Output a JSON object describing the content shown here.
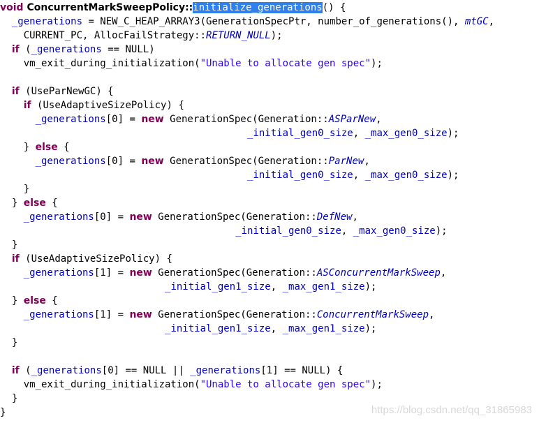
{
  "editor": {
    "lines": [
      [
        {
          "t": "void ",
          "c": "kw"
        },
        {
          "t": "ConcurrentMarkSweepPolicy::",
          "c": "sig"
        },
        {
          "t": "initialize_generations",
          "c": "hl"
        },
        {
          "t": "() {",
          "c": "plain"
        }
      ],
      [
        {
          "t": "  ",
          "c": "plain"
        },
        {
          "t": "_generations",
          "c": "field"
        },
        {
          "t": " = NEW_C_HEAP_ARRAY3(GenerationSpecPtr, number_of_generations(), ",
          "c": "plain"
        },
        {
          "t": "mtGC",
          "c": "italic"
        },
        {
          "t": ",",
          "c": "plain"
        }
      ],
      [
        {
          "t": "    CURRENT_PC, AllocFailStrategy::",
          "c": "plain"
        },
        {
          "t": "RETURN_NULL",
          "c": "italic"
        },
        {
          "t": ");",
          "c": "plain"
        }
      ],
      [
        {
          "t": "  ",
          "c": "plain"
        },
        {
          "t": "if",
          "c": "kw"
        },
        {
          "t": " (",
          "c": "plain"
        },
        {
          "t": "_generations",
          "c": "field"
        },
        {
          "t": " == NULL)",
          "c": "plain"
        }
      ],
      [
        {
          "t": "    vm_exit_during_initialization(",
          "c": "plain"
        },
        {
          "t": "\"Unable to allocate gen spec\"",
          "c": "str"
        },
        {
          "t": ");",
          "c": "plain"
        }
      ],
      [],
      [
        {
          "t": "  ",
          "c": "plain"
        },
        {
          "t": "if",
          "c": "kw"
        },
        {
          "t": " (UseParNewGC) {",
          "c": "plain"
        }
      ],
      [
        {
          "t": "    ",
          "c": "plain"
        },
        {
          "t": "if",
          "c": "kw"
        },
        {
          "t": " (UseAdaptiveSizePolicy) {",
          "c": "plain"
        }
      ],
      [
        {
          "t": "      ",
          "c": "plain"
        },
        {
          "t": "_generations",
          "c": "field"
        },
        {
          "t": "[0] = ",
          "c": "plain"
        },
        {
          "t": "new",
          "c": "kw"
        },
        {
          "t": " GenerationSpec(Generation::",
          "c": "plain"
        },
        {
          "t": "ASParNew",
          "c": "italic"
        },
        {
          "t": ",",
          "c": "plain"
        }
      ],
      [
        {
          "t": "                                          ",
          "c": "plain"
        },
        {
          "t": "_initial_gen0_size",
          "c": "field"
        },
        {
          "t": ", ",
          "c": "plain"
        },
        {
          "t": "_max_gen0_size",
          "c": "field"
        },
        {
          "t": ");",
          "c": "plain"
        }
      ],
      [
        {
          "t": "    } ",
          "c": "plain"
        },
        {
          "t": "else",
          "c": "kw"
        },
        {
          "t": " {",
          "c": "plain"
        }
      ],
      [
        {
          "t": "      ",
          "c": "plain"
        },
        {
          "t": "_generations",
          "c": "field"
        },
        {
          "t": "[0] = ",
          "c": "plain"
        },
        {
          "t": "new",
          "c": "kw"
        },
        {
          "t": " GenerationSpec(Generation::",
          "c": "plain"
        },
        {
          "t": "ParNew",
          "c": "italic"
        },
        {
          "t": ",",
          "c": "plain"
        }
      ],
      [
        {
          "t": "                                          ",
          "c": "plain"
        },
        {
          "t": "_initial_gen0_size",
          "c": "field"
        },
        {
          "t": ", ",
          "c": "plain"
        },
        {
          "t": "_max_gen0_size",
          "c": "field"
        },
        {
          "t": ");",
          "c": "plain"
        }
      ],
      [
        {
          "t": "    }",
          "c": "plain"
        }
      ],
      [
        {
          "t": "  } ",
          "c": "plain"
        },
        {
          "t": "else",
          "c": "kw"
        },
        {
          "t": " {",
          "c": "plain"
        }
      ],
      [
        {
          "t": "    ",
          "c": "plain"
        },
        {
          "t": "_generations",
          "c": "field"
        },
        {
          "t": "[0] = ",
          "c": "plain"
        },
        {
          "t": "new",
          "c": "kw"
        },
        {
          "t": " GenerationSpec(Generation::",
          "c": "plain"
        },
        {
          "t": "DefNew",
          "c": "italic"
        },
        {
          "t": ",",
          "c": "plain"
        }
      ],
      [
        {
          "t": "                                        ",
          "c": "plain"
        },
        {
          "t": "_initial_gen0_size",
          "c": "field"
        },
        {
          "t": ", ",
          "c": "plain"
        },
        {
          "t": "_max_gen0_size",
          "c": "field"
        },
        {
          "t": ");",
          "c": "plain"
        }
      ],
      [
        {
          "t": "  }",
          "c": "plain"
        }
      ],
      [
        {
          "t": "  ",
          "c": "plain"
        },
        {
          "t": "if",
          "c": "kw"
        },
        {
          "t": " (UseAdaptiveSizePolicy) {",
          "c": "plain"
        }
      ],
      [
        {
          "t": "    ",
          "c": "plain"
        },
        {
          "t": "_generations",
          "c": "field"
        },
        {
          "t": "[1] = ",
          "c": "plain"
        },
        {
          "t": "new",
          "c": "kw"
        },
        {
          "t": " GenerationSpec(Generation::",
          "c": "plain"
        },
        {
          "t": "ASConcurrentMarkSweep",
          "c": "italic"
        },
        {
          "t": ",",
          "c": "plain"
        }
      ],
      [
        {
          "t": "                            ",
          "c": "plain"
        },
        {
          "t": "_initial_gen1_size",
          "c": "field"
        },
        {
          "t": ", ",
          "c": "plain"
        },
        {
          "t": "_max_gen1_size",
          "c": "field"
        },
        {
          "t": ");",
          "c": "plain"
        }
      ],
      [
        {
          "t": "  } ",
          "c": "plain"
        },
        {
          "t": "else",
          "c": "kw"
        },
        {
          "t": " {",
          "c": "plain"
        }
      ],
      [
        {
          "t": "    ",
          "c": "plain"
        },
        {
          "t": "_generations",
          "c": "field"
        },
        {
          "t": "[1] = ",
          "c": "plain"
        },
        {
          "t": "new",
          "c": "kw"
        },
        {
          "t": " GenerationSpec(Generation::",
          "c": "plain"
        },
        {
          "t": "ConcurrentMarkSweep",
          "c": "italic"
        },
        {
          "t": ",",
          "c": "plain"
        }
      ],
      [
        {
          "t": "                            ",
          "c": "plain"
        },
        {
          "t": "_initial_gen1_size",
          "c": "field"
        },
        {
          "t": ", ",
          "c": "plain"
        },
        {
          "t": "_max_gen1_size",
          "c": "field"
        },
        {
          "t": ");",
          "c": "plain"
        }
      ],
      [
        {
          "t": "  }",
          "c": "plain"
        }
      ],
      [],
      [
        {
          "t": "  ",
          "c": "plain"
        },
        {
          "t": "if",
          "c": "kw"
        },
        {
          "t": " (",
          "c": "plain"
        },
        {
          "t": "_generations",
          "c": "field"
        },
        {
          "t": "[0] == NULL || ",
          "c": "plain"
        },
        {
          "t": "_generations",
          "c": "field"
        },
        {
          "t": "[1] == NULL) {",
          "c": "plain"
        }
      ],
      [
        {
          "t": "    vm_exit_during_initialization(",
          "c": "plain"
        },
        {
          "t": "\"Unable to allocate gen spec\"",
          "c": "str"
        },
        {
          "t": ");",
          "c": "plain"
        }
      ],
      [
        {
          "t": "  }",
          "c": "plain"
        }
      ],
      [
        {
          "t": "}",
          "c": "plain"
        }
      ]
    ]
  },
  "watermark": "https://blog.csdn.net/qq_31865983"
}
